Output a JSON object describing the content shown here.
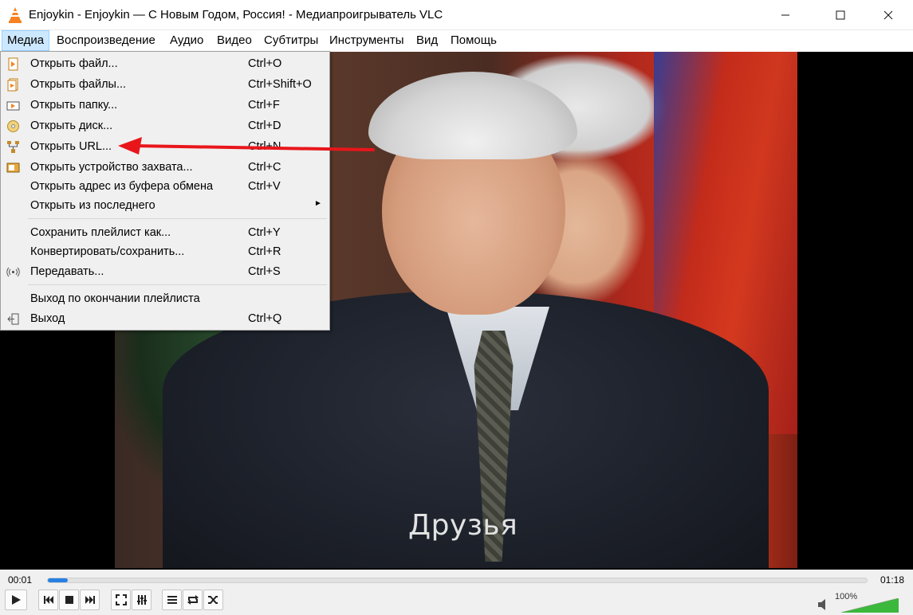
{
  "window": {
    "title": "Enjoykin - Enjoykin — С Новым Годом, Россия! - Медиапроигрыватель VLC",
    "minimize": "—",
    "maximize": "☐",
    "close": "✕"
  },
  "menubar": {
    "items": [
      {
        "label": "Медиа",
        "active": true
      },
      {
        "label": "Воспроизведение"
      },
      {
        "label": "Аудио"
      },
      {
        "label": "Видео"
      },
      {
        "label": "Субтитры"
      },
      {
        "label": "Инструменты"
      },
      {
        "label": "Вид"
      },
      {
        "label": "Помощь"
      }
    ]
  },
  "media_menu": {
    "items": [
      {
        "label": "Открыть файл...",
        "shortcut": "Ctrl+O",
        "icon": "file-play-icon"
      },
      {
        "label": "Открыть файлы...",
        "shortcut": "Ctrl+Shift+O",
        "icon": "files-play-icon"
      },
      {
        "label": "Открыть папку...",
        "shortcut": "Ctrl+F",
        "icon": "folder-icon"
      },
      {
        "label": "Открыть диск...",
        "shortcut": "Ctrl+D",
        "icon": "disc-icon"
      },
      {
        "label": "Открыть URL...",
        "shortcut": "Ctrl+N",
        "icon": "network-icon"
      },
      {
        "label": "Открыть устройство захвата...",
        "shortcut": "Ctrl+C",
        "icon": "capture-device-icon"
      },
      {
        "label": "Открыть адрес из буфера обмена",
        "shortcut": "Ctrl+V",
        "icon": ""
      },
      {
        "label": "Открыть из последнего",
        "shortcut": "",
        "submenu": "►"
      },
      {
        "label": "Сохранить плейлист как...",
        "shortcut": "Ctrl+Y"
      },
      {
        "label": "Конвертировать/сохранить...",
        "shortcut": "Ctrl+R"
      },
      {
        "label": "Передавать...",
        "shortcut": "Ctrl+S",
        "icon": "stream-icon"
      },
      {
        "label": "Выход по окончании плейлиста",
        "shortcut": ""
      },
      {
        "label": "Выход",
        "shortcut": "Ctrl+Q",
        "icon": "exit-icon"
      }
    ]
  },
  "video": {
    "subtitle": "Друзья"
  },
  "controls": {
    "time_elapsed": "00:01",
    "time_total": "01:18",
    "progress": 0.02,
    "volume_label": "100%",
    "volume": 1.0
  },
  "colors": {
    "accent": "#2780e3",
    "menu_highlight": "#cce8ff",
    "annotation_arrow": "#e8161b",
    "volume_green": "#3cb83c"
  }
}
